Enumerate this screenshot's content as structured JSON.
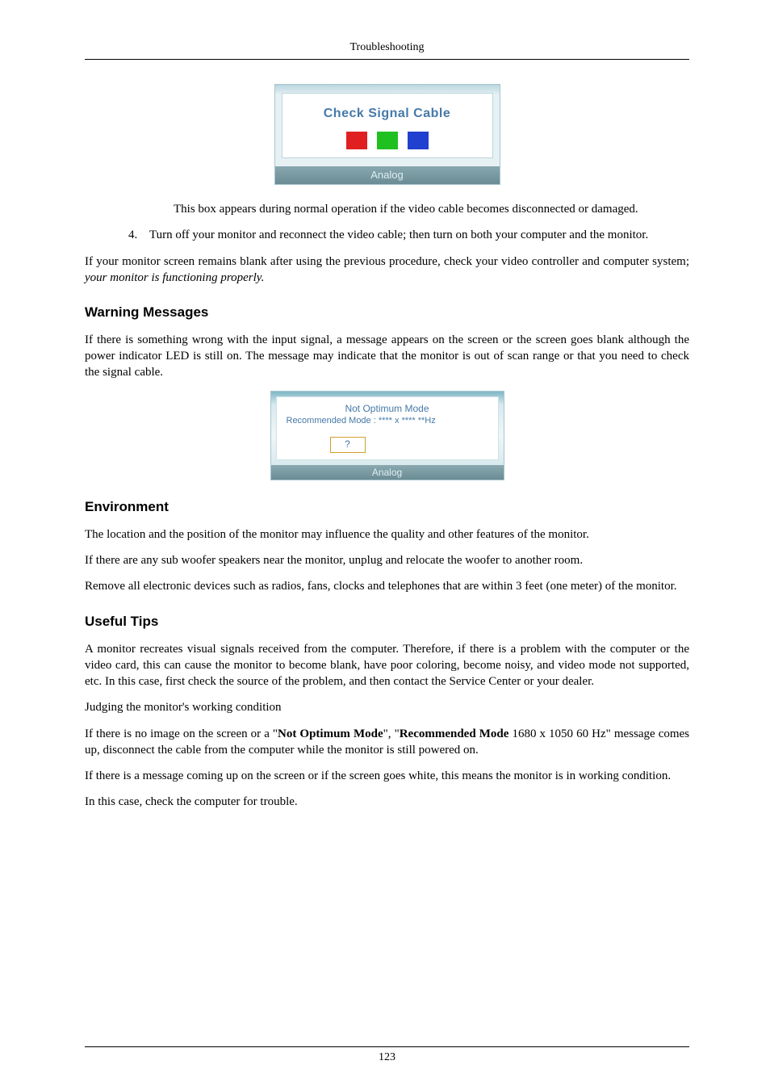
{
  "header": "Troubleshooting",
  "page_number": "123",
  "fig1": {
    "title": "Check Signal Cable",
    "footer": "Analog"
  },
  "caption_after_fig1": "This box appears during normal operation if the video cable becomes disconnected or damaged.",
  "item4": {
    "num": "4.",
    "text": "Turn off your monitor and reconnect the video cable; then turn on both your computer and the monitor."
  },
  "after_list_pre": "If your monitor screen remains blank after using the previous procedure, check your video controller and computer system; ",
  "after_list_italic": "your monitor is functioning properly.",
  "sec_warning": {
    "heading": "Warning Messages",
    "para": "If there is something wrong with the input signal, a message appears on the screen or the screen goes blank although the power indicator LED is still on. The message may indicate that the monitor is out of scan range or that you need to check the signal cable."
  },
  "fig2": {
    "line1": "Not Optimum Mode",
    "line2": "Recommended Mode : **** x ****  **Hz",
    "q": "?",
    "footer": "Analog"
  },
  "sec_env": {
    "heading": "Environment",
    "p1": "The location and the position of the monitor may influence the quality and other features of the monitor.",
    "p2": "If there are any sub woofer speakers near the monitor, unplug and relocate the woofer to another room.",
    "p3": "Remove all electronic devices such as radios, fans, clocks and telephones that are within 3 feet (one meter) of the monitor."
  },
  "sec_tips": {
    "heading": "Useful Tips",
    "p1": "A monitor recreates visual signals received from the computer. Therefore, if there is a problem with the computer or the video card, this can cause the monitor to become blank, have poor coloring, become noisy, and video mode not supported, etc. In this case, first check the source of the problem, and then contact the Service Center or your dealer.",
    "p2": "Judging the monitor's working condition",
    "p3_pre": "If there is no image on the screen or a \"",
    "p3_b1": "Not Optimum Mode",
    "p3_mid": "\", \"",
    "p3_b2": "Recommended Mode",
    "p3_post": " 1680 x 1050 60 Hz\" message comes up, disconnect the cable from the computer while the monitor is still powered on.",
    "p4": "If there is a message coming up on the screen or if the screen goes white, this means the monitor is in working condition.",
    "p5": "In this case, check the computer for trouble."
  }
}
